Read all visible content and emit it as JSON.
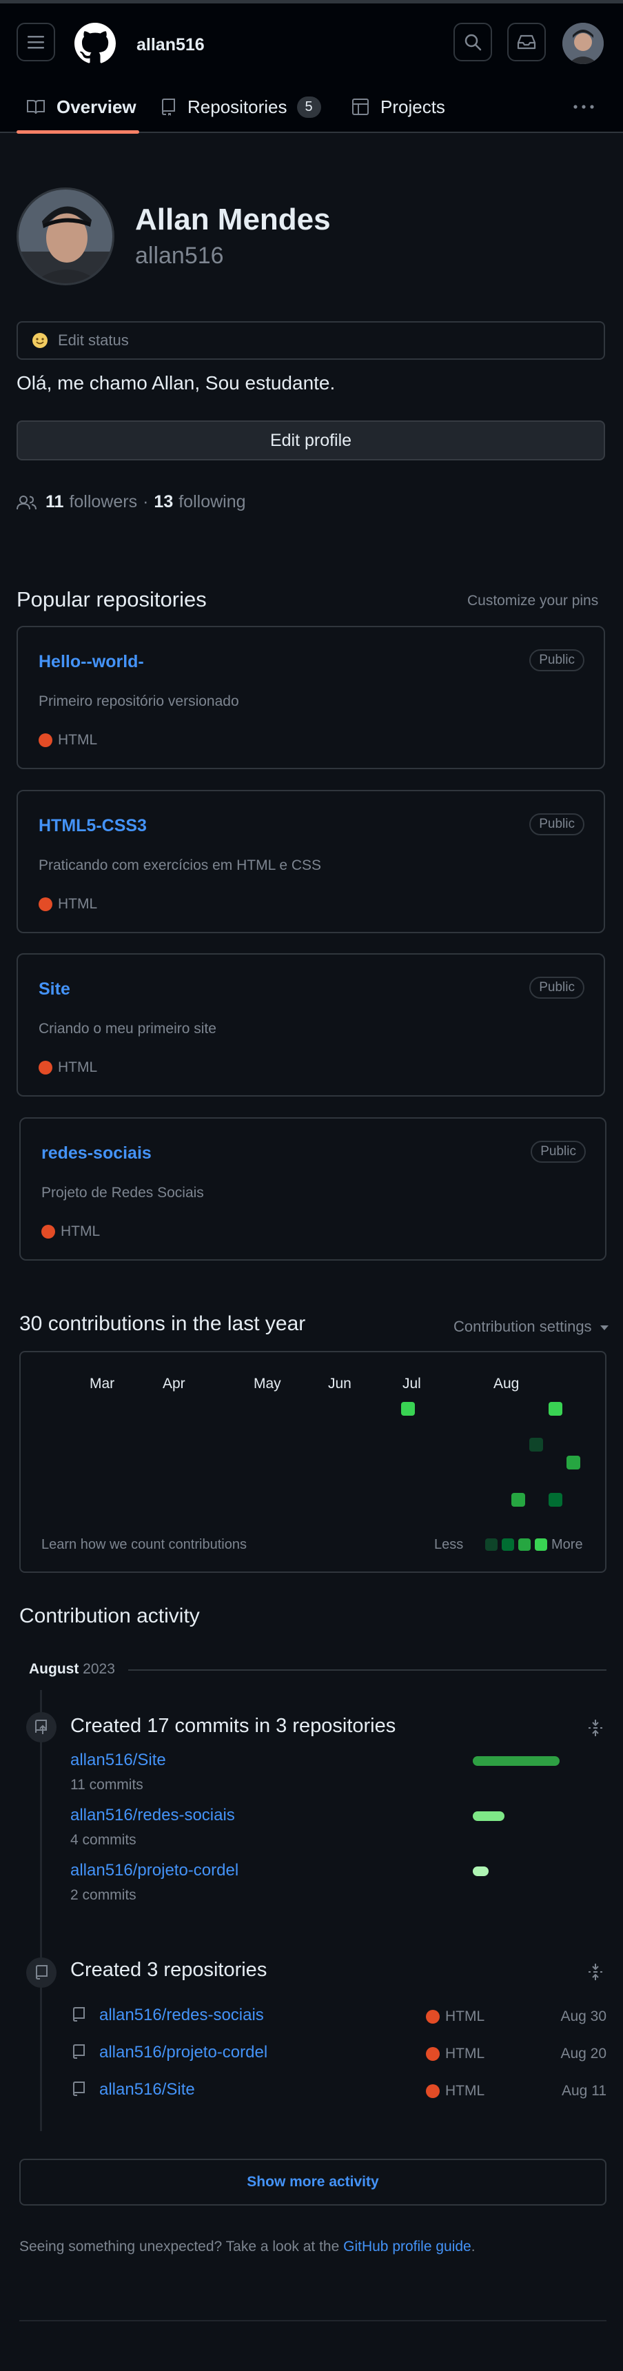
{
  "header": {
    "username": "allan516",
    "icons": [
      "hamburger-menu-icon",
      "github-logo-icon",
      "search-icon",
      "inbox-icon",
      "avatar"
    ]
  },
  "tabs": [
    {
      "label": "Overview",
      "icon": "book-icon",
      "selected": true
    },
    {
      "label": "Repositories",
      "icon": "repo-icon",
      "count": "5"
    },
    {
      "label": "Projects",
      "icon": "table-icon"
    }
  ],
  "profile": {
    "full_name": "Allan Mendes",
    "login": "allan516",
    "edit_status_label": "Edit status",
    "bio": "Olá, me chamo Allan, Sou estudante.",
    "edit_profile_label": "Edit profile",
    "followers_count": "11",
    "followers_label": "followers",
    "separator": "·",
    "following_count": "13",
    "following_label": "following"
  },
  "popular": {
    "title": "Popular repositories",
    "customize_label": "Customize your pins",
    "repos": [
      {
        "name": "Hello--world-",
        "visibility": "Public",
        "description": "Primeiro repositório versionado",
        "language": "HTML"
      },
      {
        "name": "HTML5-CSS3",
        "visibility": "Public",
        "description": "Praticando com exercícios em HTML e CSS",
        "language": "HTML"
      },
      {
        "name": "Site",
        "visibility": "Public",
        "description": "Criando o meu primeiro site",
        "language": "HTML"
      },
      {
        "name": "redes-sociais",
        "visibility": "Public",
        "description": "Projeto de Redes Sociais",
        "language": "HTML"
      }
    ]
  },
  "contributions": {
    "title": "30 contributions in the last year",
    "settings_label": "Contribution settings",
    "months": [
      "Mar",
      "Apr",
      "May",
      "Jun",
      "Jul",
      "Aug"
    ],
    "learn_label": "Learn how we count contributions",
    "legend_less": "Less",
    "legend_more": "More",
    "legend_colors": [
      "#0e4429",
      "#006d32",
      "#26a641",
      "#39d353"
    ]
  },
  "activity": {
    "title": "Contribution activity",
    "month": "August",
    "year": "2023",
    "commits": {
      "heading": "Created 17 commits in 3 repositories",
      "rows": [
        {
          "repo": "allan516/Site",
          "count_label": "11 commits",
          "commits": 11
        },
        {
          "repo": "allan516/redes-sociais",
          "count_label": "4 commits",
          "commits": 4
        },
        {
          "repo": "allan516/projeto-cordel",
          "count_label": "2 commits",
          "commits": 2
        }
      ]
    },
    "created": {
      "heading": "Created 3 repositories",
      "rows": [
        {
          "repo": "allan516/redes-sociais",
          "language": "HTML",
          "date": "Aug 30"
        },
        {
          "repo": "allan516/projeto-cordel",
          "language": "HTML",
          "date": "Aug 20"
        },
        {
          "repo": "allan516/Site",
          "language": "HTML",
          "date": "Aug 11"
        }
      ]
    },
    "show_more_label": "Show more activity"
  },
  "footer": {
    "note_prefix": "Seeing something unexpected? Take a look at the ",
    "note_link": "GitHub profile guide",
    "note_suffix": "."
  },
  "colors": {
    "background": "#0d1117",
    "accent": "#f78166",
    "link": "#4493f8",
    "html_language": "#e34c26"
  }
}
